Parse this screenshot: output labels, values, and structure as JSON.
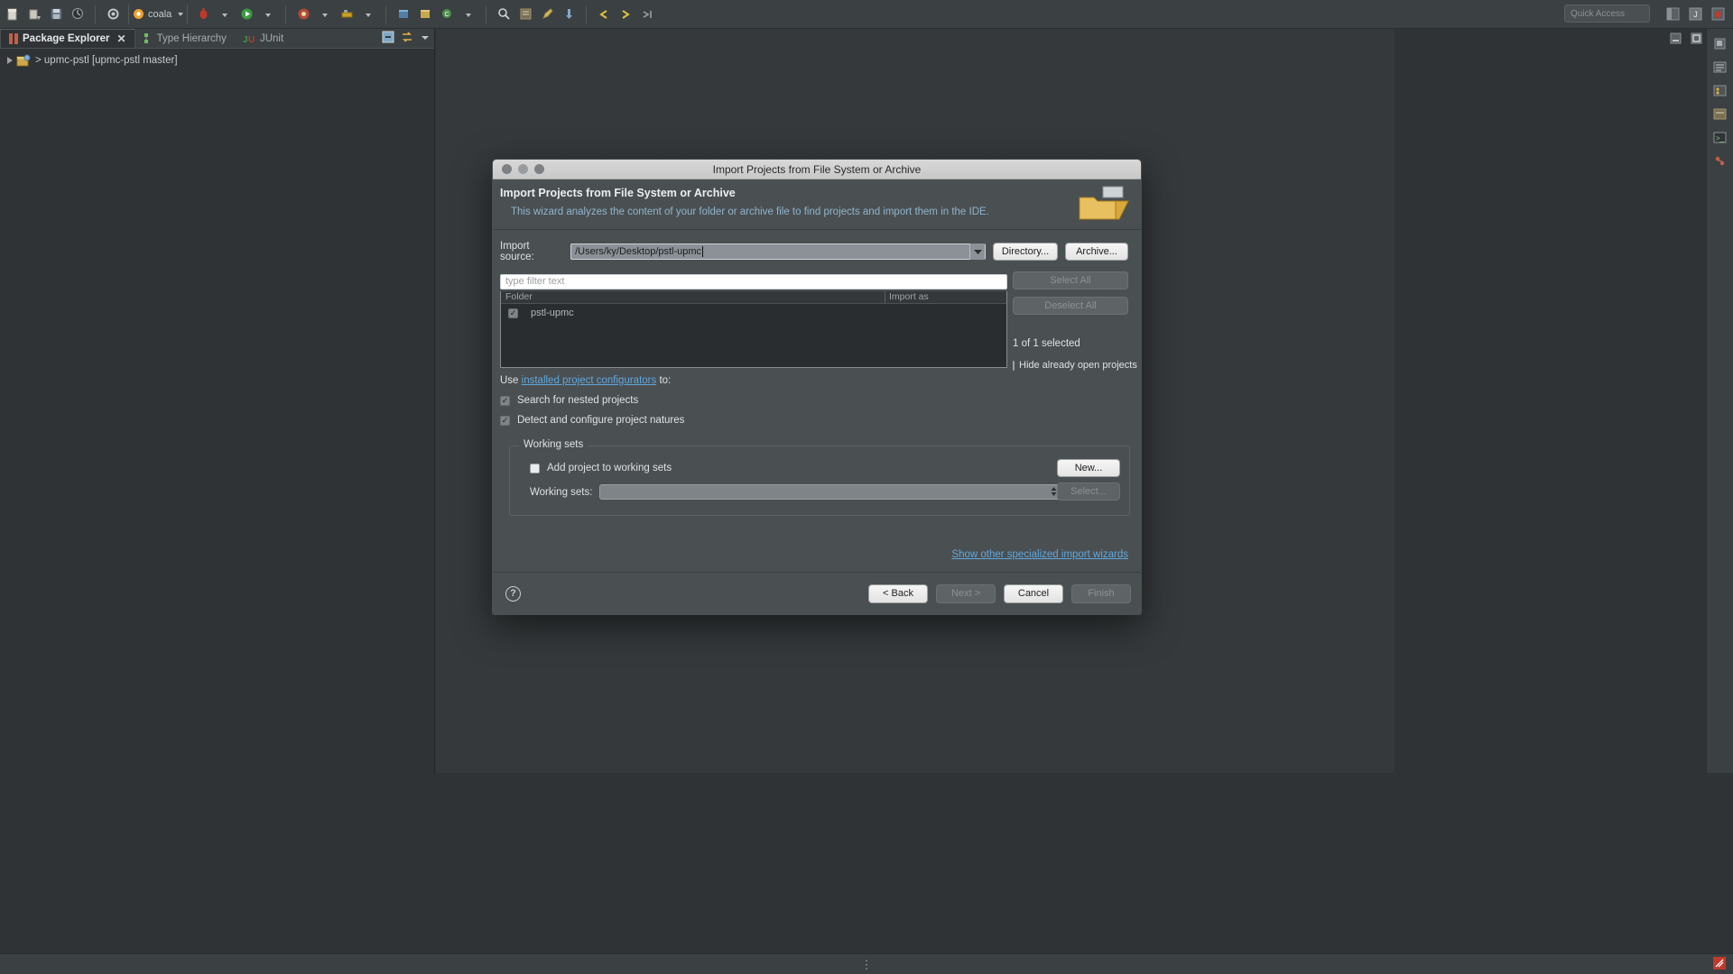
{
  "toolbar": {
    "quick_access_placeholder": "Quick Access",
    "coala_label": "coala",
    "icons": [
      "new-file-icon",
      "new-wizard-dropdown-icon",
      "save-icon",
      "print-icon",
      "coala-run-icon",
      "settings-gear-icon",
      "debug-icon",
      "run-icon",
      "run-dropdown-icon",
      "coverage-icon",
      "external-tools-icon",
      "new-java-project-icon",
      "new-package-icon",
      "new-class-icon",
      "search-icon",
      "open-type-icon",
      "edit-icon",
      "pin-icon",
      "back-icon",
      "forward-icon",
      "next-annotation-icon"
    ],
    "perspective_icons": [
      "open-perspective-icon",
      "java-perspective-icon",
      "debug-perspective-icon"
    ]
  },
  "left_view": {
    "tabs": [
      {
        "label": "Package Explorer",
        "icon": "package-explorer-icon",
        "active": true,
        "closable": true
      },
      {
        "label": "Type Hierarchy",
        "icon": "type-hierarchy-icon",
        "active": false,
        "closable": false
      },
      {
        "label": "JUnit",
        "icon": "junit-icon",
        "active": false,
        "closable": false
      }
    ],
    "tab_tools": [
      "collapse-all-icon",
      "link-with-editor-icon",
      "view-menu-icon",
      "minimize-icon",
      "maximize-icon"
    ],
    "tree": [
      {
        "label": "> upmc-pstl [upmc-pstl master]",
        "icon": "java-project-icon",
        "expanded": false
      }
    ]
  },
  "dialog": {
    "window_title": "Import Projects from File System or Archive",
    "heading": "Import Projects from File System or Archive",
    "description": "This wizard analyzes the content of your folder or archive file to find projects and import them in the IDE.",
    "import_source": {
      "label": "Import source:",
      "value": "/Users/ky/Desktop/pstl-upmc",
      "directory_button": "Directory...",
      "archive_button": "Archive..."
    },
    "filter_placeholder": "type filter text",
    "table": {
      "columns": [
        "Folder",
        "Import as"
      ],
      "rows": [
        {
          "checked": true,
          "folder": "pstl-upmc",
          "import_as": ""
        }
      ]
    },
    "select_all_button": "Select All",
    "deselect_all_button": "Deselect All",
    "selection_count": "1 of 1 selected",
    "hide_already_open": {
      "label": "Hide already open projects",
      "checked": false
    },
    "configurators": {
      "prefix": "Use ",
      "link": "installed project configurators",
      "suffix": " to:",
      "options": [
        {
          "label": "Search for nested projects",
          "checked": true
        },
        {
          "label": "Detect and configure project natures",
          "checked": true
        }
      ]
    },
    "working_sets": {
      "group_title": "Working sets",
      "add_checkbox": {
        "label": "Add project to working sets",
        "checked": false
      },
      "select_label": "Working sets:",
      "select_value": "",
      "new_button": "New...",
      "select_button": "Select..."
    },
    "show_other_link": "Show other specialized import wizards",
    "footer": {
      "help": "?",
      "back": "< Back",
      "next": "Next >",
      "cancel": "Cancel",
      "finish": "Finish"
    }
  },
  "statusbar": {
    "dots": "⋮",
    "right_icon": "resize-grip-icon"
  },
  "colors": {
    "app_bg": "#2f3335",
    "toolbar_bg": "#3b4043",
    "dialog_bg": "#4a4f52",
    "link": "#5fa8dc",
    "desc_text": "#8fb5cc",
    "text": "#dfe2e3"
  }
}
